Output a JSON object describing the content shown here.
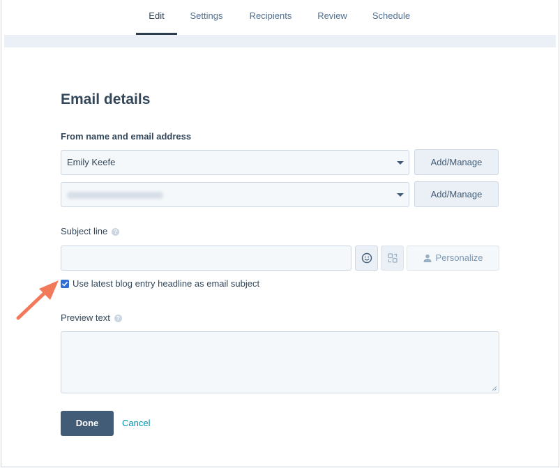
{
  "tabs": [
    {
      "label": "Edit",
      "active": true
    },
    {
      "label": "Settings",
      "active": false
    },
    {
      "label": "Recipients",
      "active": false
    },
    {
      "label": "Review",
      "active": false
    },
    {
      "label": "Schedule",
      "active": false
    }
  ],
  "form": {
    "title": "Email details",
    "from_label": "From name and email address",
    "from_name_value": "Emily Keefe",
    "from_email_value": "",
    "add_manage_label": "Add/Manage",
    "subject_label": "Subject line",
    "subject_value": "",
    "personalize_label": "Personalize",
    "checkbox_label": "Use latest blog entry headline as email subject",
    "checkbox_checked": true,
    "preview_label": "Preview text",
    "preview_value": "",
    "help_glyph": "?",
    "done_label": "Done",
    "cancel_label": "Cancel"
  },
  "colors": {
    "accent_dark": "#425b76",
    "link": "#0091ae",
    "checkbox": "#2f6fd5",
    "annotation_arrow": "#f2795a"
  },
  "icons": [
    "dropdown-caret-icon",
    "help-icon",
    "emoji-icon",
    "snippet-icon",
    "person-icon",
    "check-icon",
    "resize-handle-icon",
    "annotation-arrow-icon"
  ]
}
